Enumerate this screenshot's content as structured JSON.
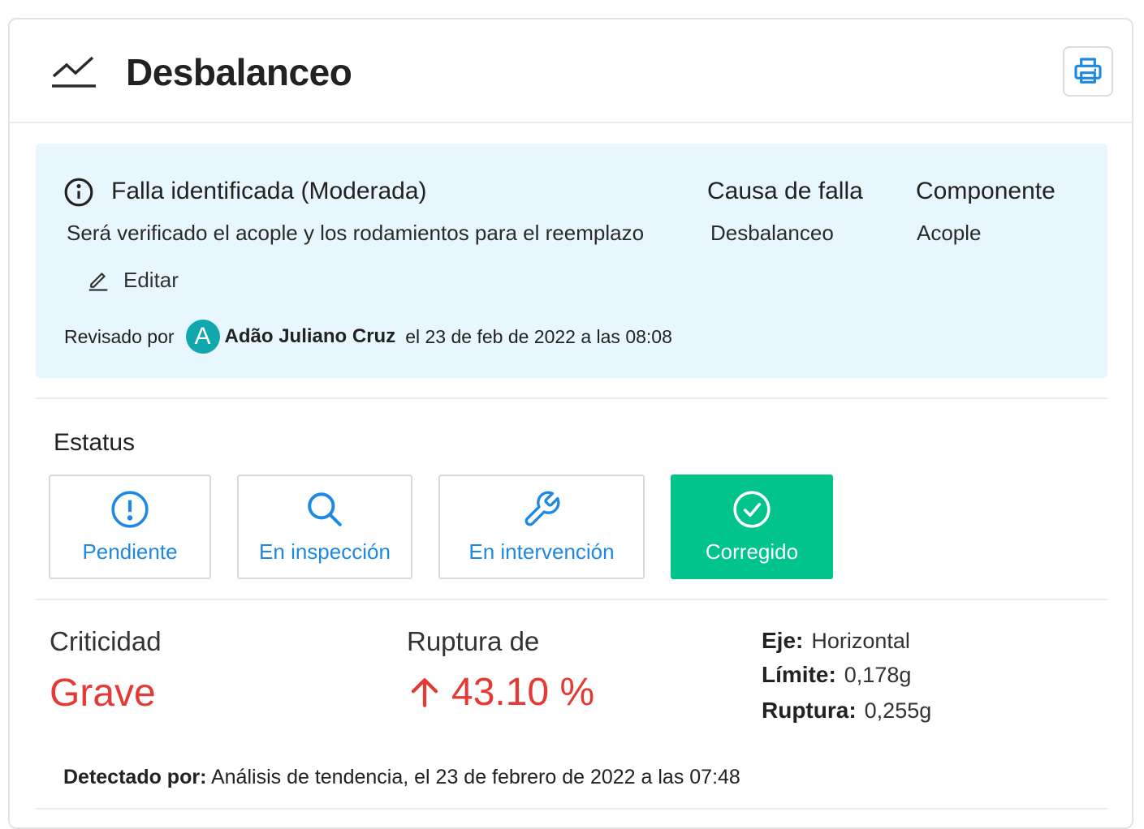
{
  "header": {
    "title": "Desbalanceo",
    "icon": "trend-chart-icon",
    "print_icon": "printer-icon"
  },
  "fault": {
    "title": "Falla identificada (Moderada)",
    "description": "Será verificado el acople y los rodamientos para el reemplazo",
    "edit_label": "Editar",
    "cause_title": "Causa de falla",
    "cause_value": "Desbalanceo",
    "component_title": "Componente",
    "component_value": "Acople",
    "reviewed_label": "Revisado por",
    "reviewer_initial": "A",
    "reviewer_name": "Adão Juliano Cruz",
    "reviewed_date": "el 23 de feb de 2022 a las 08:08"
  },
  "status": {
    "title": "Estatus",
    "options": [
      {
        "label": "Pendiente",
        "icon": "alert-circle-icon"
      },
      {
        "label": "En inspección",
        "icon": "search-icon"
      },
      {
        "label": "En intervención",
        "icon": "wrench-icon"
      },
      {
        "label": "Corregido",
        "icon": "check-circle-icon"
      }
    ],
    "selected": "Corregido"
  },
  "metrics": {
    "criticality_title": "Criticidad",
    "criticality_value": "Grave",
    "rupture_title": "Ruptura de",
    "rupture_value": "43.10 %",
    "axis_label": "Eje:",
    "axis_value": "Horizontal",
    "limit_label": "Límite:",
    "limit_value": "0,178g",
    "rupture_label": "Ruptura:",
    "rupture_val": "0,255g"
  },
  "detected": {
    "label": "Detectado por:",
    "value": " Análisis de tendencia, el 23 de febrero de 2022 a las 07:48"
  },
  "colors": {
    "accent_blue": "#1e88e5",
    "success_green": "#00c48c",
    "danger_red": "#e53935",
    "info_bg": "#e8f6fd",
    "avatar_teal": "#11a8ad"
  }
}
